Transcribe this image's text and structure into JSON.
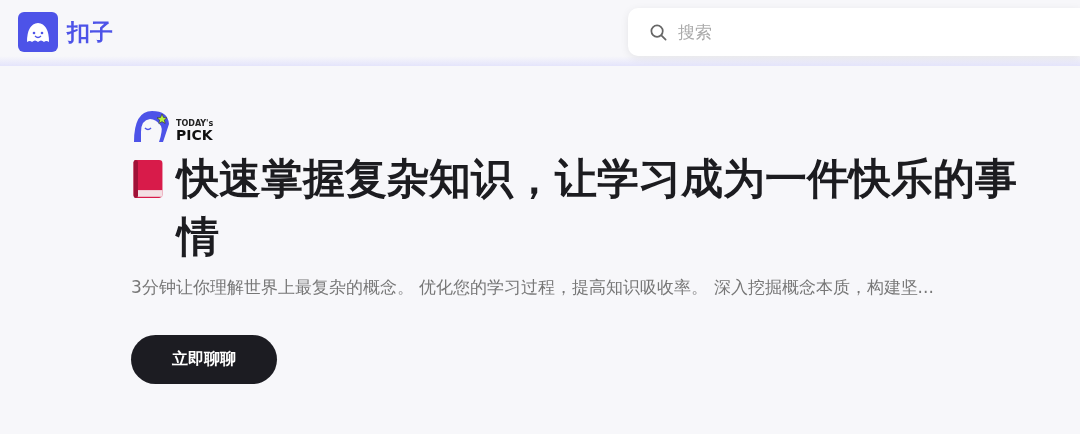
{
  "header": {
    "brand": "扣子",
    "search": {
      "placeholder": "搜索"
    }
  },
  "feature": {
    "badge": {
      "line_1": "TODAY's",
      "line_2": "PICK"
    },
    "title": "快速掌握复杂知识，让学习成为一件快乐的事情",
    "description": "3分钟让你理解世界上最复杂的概念。 优化您的学习过程，提高知识吸收率。 深入挖掘概念本质，构建坚...",
    "button": "立即聊聊"
  }
}
